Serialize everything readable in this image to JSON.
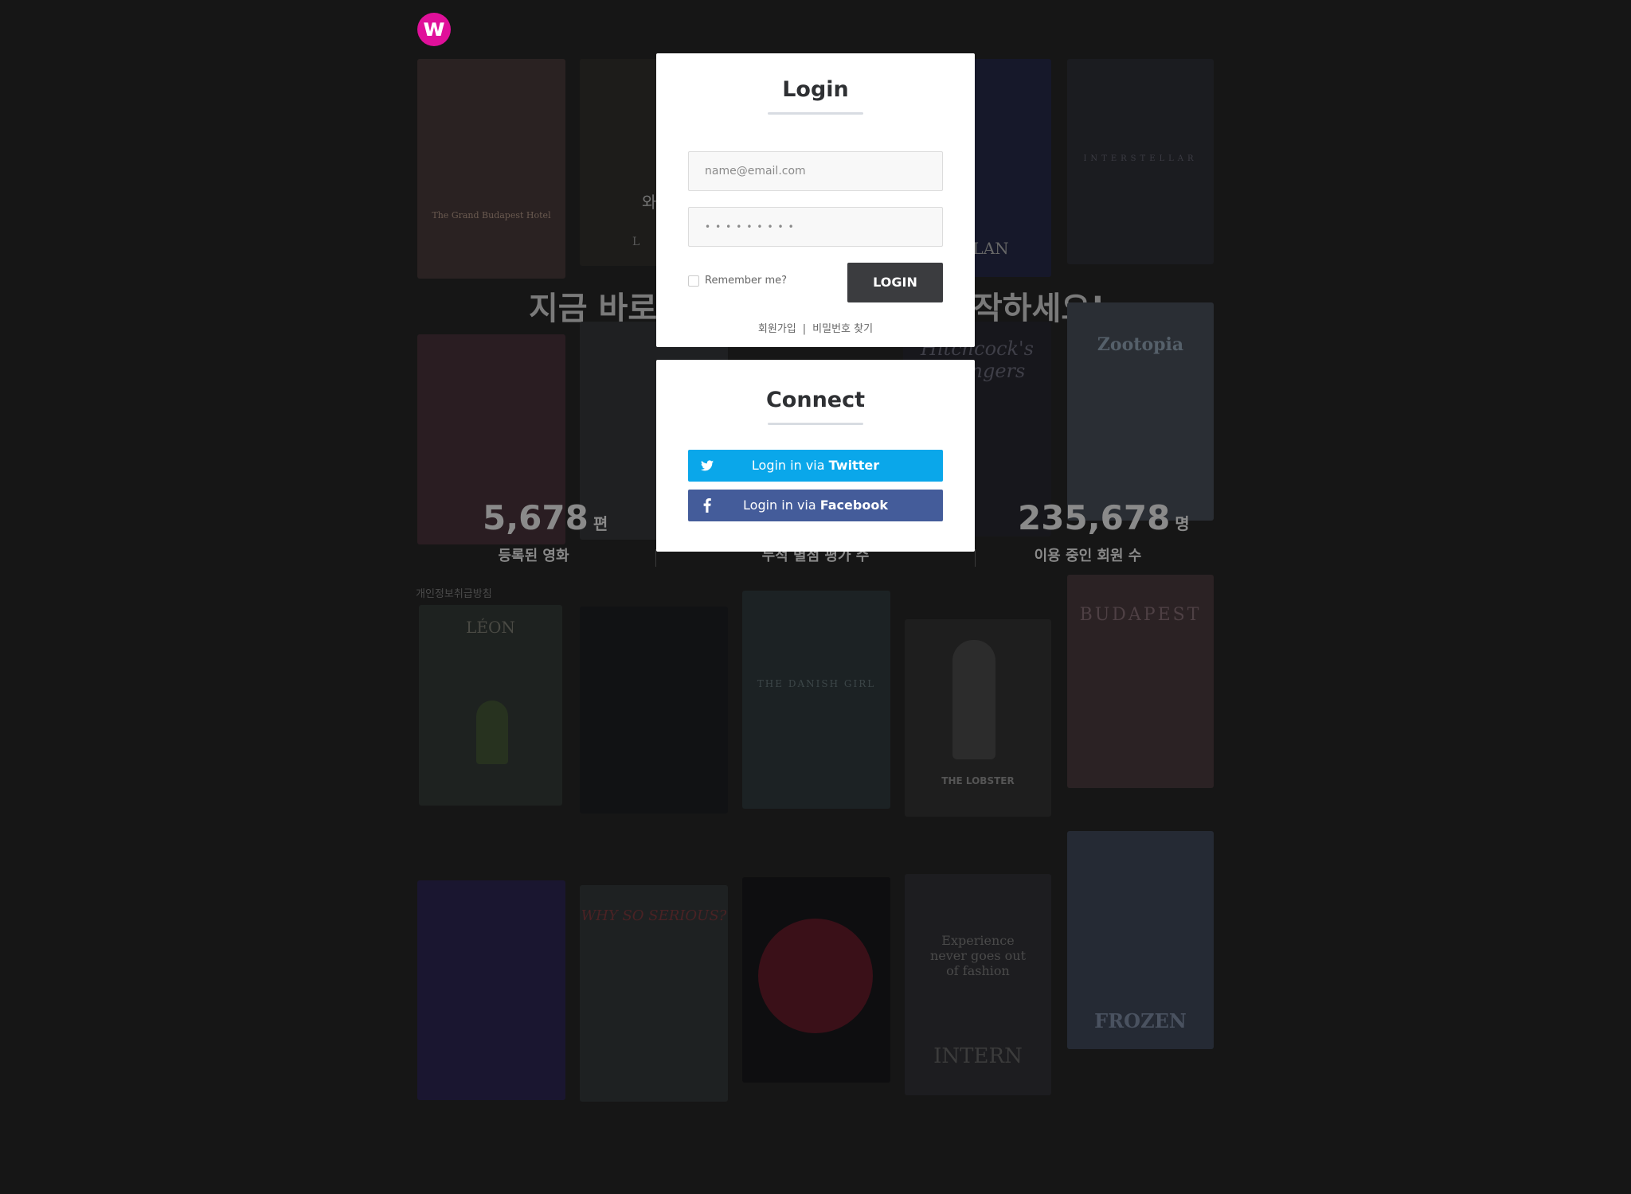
{
  "brand": {
    "logo_letter": "w",
    "accent": "#e0109a"
  },
  "background": {
    "headline_left": "지금 바로",
    "headline_right": "작하세요!",
    "peek_left": "와",
    "peek_right": "~",
    "stats": [
      {
        "value": "5,678",
        "unit": "편",
        "label": "등록된 영화"
      },
      {
        "value": "",
        "unit": "",
        "label": "누적 별점 평가 수"
      },
      {
        "value": "235,678",
        "unit": "명",
        "label": "이용 중인 회원 수"
      }
    ],
    "privacy": "개인정보취급방침",
    "posters": [
      {
        "caption": "The Grand Budapest Hotel"
      },
      {
        "caption": "L E"
      },
      {
        "caption": ""
      },
      {
        "caption": "LA LAN"
      },
      {
        "caption": "INTERSTELLAR"
      },
      {
        "caption": ""
      },
      {
        "caption": ""
      },
      {
        "caption": ""
      },
      {
        "caption": "Hitchcock's Strangers"
      },
      {
        "caption": "Zootopia"
      },
      {
        "caption": "LÉON"
      },
      {
        "caption": ""
      },
      {
        "caption": "THE DANISH GIRL"
      },
      {
        "caption": "THE LOBSTER"
      },
      {
        "caption": "BUDAPEST"
      },
      {
        "caption": ""
      },
      {
        "caption": "WHY SO SERIOUS?"
      },
      {
        "caption": ""
      },
      {
        "caption": "Experience never goes out of fashion"
      },
      {
        "caption": "INTERN"
      },
      {
        "caption": "FROZEN"
      }
    ]
  },
  "login": {
    "title": "Login",
    "email_placeholder": "name@email.com",
    "password_mask": "•••••••••",
    "remember_label": "Remember me?",
    "login_button": "LOGIN",
    "signup_link": "회원가입",
    "separator": "|",
    "find_password_link": "비밀번호 찾기"
  },
  "connect": {
    "title": "Connect",
    "twitter_prefix": "Login in via ",
    "twitter_brand": "Twitter",
    "facebook_prefix": "Login in via ",
    "facebook_brand": "Facebook",
    "twitter_color": "#0aa7ea",
    "facebook_color": "#445c9a",
    "icons": [
      "twitter-icon",
      "facebook-icon"
    ]
  }
}
